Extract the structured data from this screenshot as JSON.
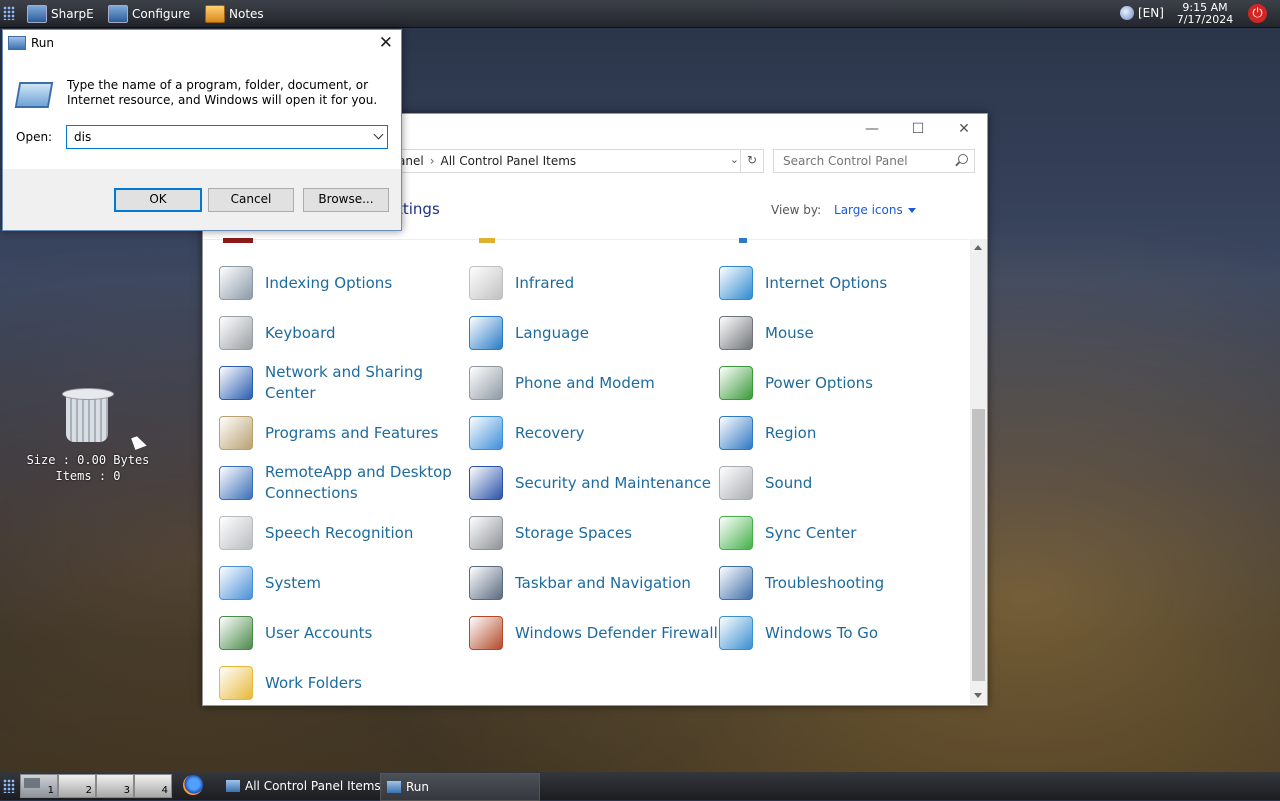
{
  "topbar": {
    "apps": [
      {
        "label": "SharpE",
        "icon": "monitor-icon"
      },
      {
        "label": "Configure",
        "icon": "monitor-icon"
      },
      {
        "label": "Notes",
        "icon": "notes-icon"
      }
    ],
    "language": "[EN]",
    "time": "9:15 AM",
    "date": "7/17/2024"
  },
  "desktop": {
    "recycle_bin": {
      "size_text": "Size : 0.00 Bytes",
      "items_text": "Items : 0"
    }
  },
  "control_panel": {
    "address": {
      "crumb_partial": "anel",
      "current": "All Control Panel Items"
    },
    "search_placeholder": "Search Control Panel",
    "heading_partial": "ttings",
    "view_by_label": "View by:",
    "view_by_value": "Large icons",
    "items": [
      {
        "label": "Indexing Options",
        "icon": "indexing-options-icon",
        "color": "#8a9aa8"
      },
      {
        "label": "Infrared",
        "icon": "infrared-icon",
        "color": "#c0c0c0"
      },
      {
        "label": "Internet Options",
        "icon": "internet-options-icon",
        "color": "#2e8bd0"
      },
      {
        "label": "Keyboard",
        "icon": "keyboard-icon",
        "color": "#9aa0a6"
      },
      {
        "label": "Language",
        "icon": "language-icon",
        "color": "#2a7cc7"
      },
      {
        "label": "Mouse",
        "icon": "mouse-icon",
        "color": "#6f7479"
      },
      {
        "label": "Network and Sharing Center",
        "icon": "network-sharing-icon",
        "color": "#2a5db0"
      },
      {
        "label": "Phone and Modem",
        "icon": "phone-modem-icon",
        "color": "#8e99a3"
      },
      {
        "label": "Power Options",
        "icon": "power-options-icon",
        "color": "#3a9a3a"
      },
      {
        "label": "Programs and Features",
        "icon": "programs-features-icon",
        "color": "#b9a070"
      },
      {
        "label": "Recovery",
        "icon": "recovery-icon",
        "color": "#3b8ed8"
      },
      {
        "label": "Region",
        "icon": "region-icon",
        "color": "#2f78c4"
      },
      {
        "label": "RemoteApp and Desktop Connections",
        "icon": "remoteapp-icon",
        "color": "#3a6fb8"
      },
      {
        "label": "Security and Maintenance",
        "icon": "security-flag-icon",
        "color": "#2a52a8"
      },
      {
        "label": "Sound",
        "icon": "sound-icon",
        "color": "#a9adb2"
      },
      {
        "label": "Speech Recognition",
        "icon": "microphone-icon",
        "color": "#b8bcc0"
      },
      {
        "label": "Storage Spaces",
        "icon": "storage-spaces-icon",
        "color": "#8d9298"
      },
      {
        "label": "Sync Center",
        "icon": "sync-center-icon",
        "color": "#45b04a"
      },
      {
        "label": "System",
        "icon": "system-icon",
        "color": "#4a90d8"
      },
      {
        "label": "Taskbar and Navigation",
        "icon": "taskbar-navigation-icon",
        "color": "#5a6a80"
      },
      {
        "label": "Troubleshooting",
        "icon": "troubleshooting-icon",
        "color": "#3f6fa8"
      },
      {
        "label": "User Accounts",
        "icon": "user-accounts-icon",
        "color": "#4a8a4a"
      },
      {
        "label": "Windows Defender Firewall",
        "icon": "firewall-icon",
        "color": "#b24a2a"
      },
      {
        "label": "Windows To Go",
        "icon": "windows-to-go-icon",
        "color": "#3a8fd0"
      },
      {
        "label": "Work Folders",
        "icon": "work-folders-icon",
        "color": "#e8b83a"
      }
    ]
  },
  "run_dialog": {
    "title": "Run",
    "description": "Type the name of a program, folder, document, or Internet resource, and Windows will open it for you.",
    "open_label": "Open:",
    "open_value": "dis",
    "ok_label": "OK",
    "cancel_label": "Cancel",
    "browse_label": "Browse..."
  },
  "taskbar": {
    "workspaces": [
      "1",
      "2",
      "3",
      "4"
    ],
    "tasks": [
      {
        "label": "All Control Panel Items"
      },
      {
        "label": "Run"
      }
    ]
  }
}
